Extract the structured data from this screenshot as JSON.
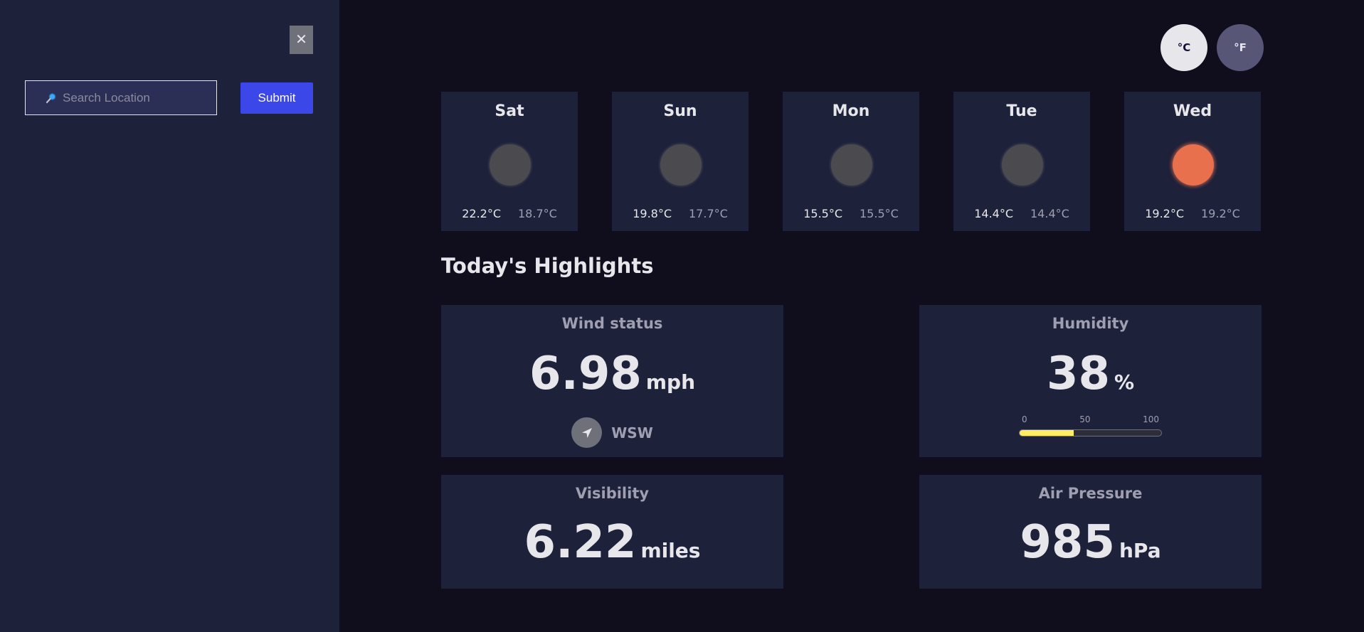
{
  "sidebar": {
    "close_icon": "close-icon",
    "close_label": "✕",
    "search_placeholder": "Search Location",
    "search_icon": "search-icon",
    "submit_label": "Submit"
  },
  "units": {
    "celsius_label": "°C",
    "fahrenheit_label": "°F",
    "selected": "celsius"
  },
  "forecast": [
    {
      "day": "Sat",
      "max": "22.2°C",
      "min": "18.7°C",
      "icon": "cloudy-icon"
    },
    {
      "day": "Sun",
      "max": "19.8°C",
      "min": "17.7°C",
      "icon": "cloudy-icon"
    },
    {
      "day": "Mon",
      "max": "15.5°C",
      "min": "15.5°C",
      "icon": "cloudy-icon"
    },
    {
      "day": "Tue",
      "max": "14.4°C",
      "min": "14.4°C",
      "icon": "cloudy-icon"
    },
    {
      "day": "Wed",
      "max": "19.2°C",
      "min": "19.2°C",
      "icon": "sun-icon"
    }
  ],
  "highlights": {
    "title": "Today's Highlights",
    "wind": {
      "label": "Wind status",
      "value": "6.98",
      "unit": "mph",
      "direction": "WSW"
    },
    "humidity": {
      "label": "Humidity",
      "value": "38",
      "unit": "%",
      "percent": 38,
      "scale": [
        "0",
        "50",
        "100"
      ]
    },
    "visibility": {
      "label": "Visibility",
      "value": "6.22",
      "unit": "miles"
    },
    "pressure": {
      "label": "Air Pressure",
      "value": "985",
      "unit": "hPa"
    }
  },
  "colors": {
    "background": "#100e1d",
    "card": "#1e213a",
    "accent": "#3c47e9",
    "humidity_fill": "#ffec65",
    "sun": "#e9704c"
  }
}
